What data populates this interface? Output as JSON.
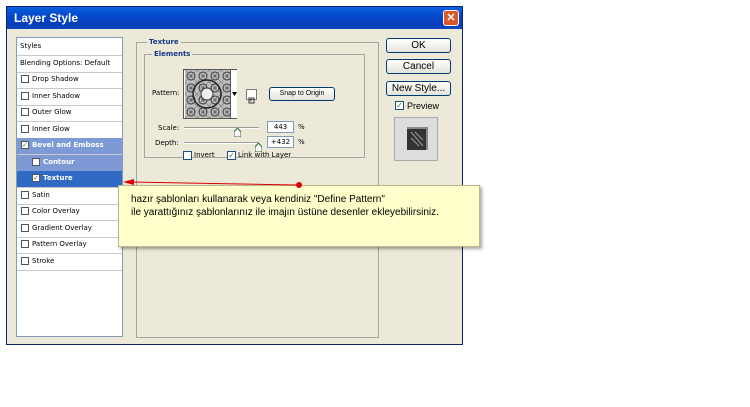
{
  "window": {
    "title": "Layer Style",
    "close_glyph": "✕"
  },
  "styles_list": [
    {
      "label": "Styles",
      "checkbox": false,
      "checked": false,
      "selected": false,
      "sub": false
    },
    {
      "label": "Blending Options: Default",
      "checkbox": false,
      "checked": false,
      "selected": false,
      "sub": false
    },
    {
      "label": "Drop Shadow",
      "checkbox": true,
      "checked": false,
      "selected": false,
      "sub": false
    },
    {
      "label": "Inner Shadow",
      "checkbox": true,
      "checked": false,
      "selected": false,
      "sub": false
    },
    {
      "label": "Outer Glow",
      "checkbox": true,
      "checked": false,
      "selected": false,
      "sub": false
    },
    {
      "label": "Inner Glow",
      "checkbox": true,
      "checked": false,
      "selected": false,
      "sub": false
    },
    {
      "label": "Bevel and Emboss",
      "checkbox": true,
      "checked": true,
      "selected": true,
      "sub": false
    },
    {
      "label": "Contour",
      "checkbox": true,
      "checked": false,
      "selected": true,
      "sub": true
    },
    {
      "label": "Texture",
      "checkbox": true,
      "checked": true,
      "selected": true,
      "sub": true
    },
    {
      "label": "Satin",
      "checkbox": true,
      "checked": false,
      "selected": false,
      "sub": false
    },
    {
      "label": "Color Overlay",
      "checkbox": true,
      "checked": false,
      "selected": false,
      "sub": false
    },
    {
      "label": "Gradient Overlay",
      "checkbox": true,
      "checked": false,
      "selected": false,
      "sub": false
    },
    {
      "label": "Pattern Overlay",
      "checkbox": true,
      "checked": false,
      "selected": false,
      "sub": false
    },
    {
      "label": "Stroke",
      "checkbox": true,
      "checked": false,
      "selected": false,
      "sub": false
    }
  ],
  "texture": {
    "section_title": "Texture",
    "group_title": "Elements",
    "pattern_label": "Pattern:",
    "snap_button": "Snap to Origin",
    "scale_label": "Scale:",
    "scale_value": "443",
    "scale_unit": "%",
    "depth_label": "Depth:",
    "depth_value": "+432",
    "depth_unit": "%",
    "invert_label": "Invert",
    "invert_checked": false,
    "link_label": "Link with Layer",
    "link_checked": true
  },
  "buttons": {
    "ok": "OK",
    "cancel": "Cancel",
    "new_style": "New Style...",
    "preview_label": "Preview"
  },
  "preview_checked": true,
  "tooltip": {
    "line1": "hazır şablonları kullanarak veya kendiniz \"Define Pattern\"",
    "line2": "ile yarattığınız şablonlarınız ile imajın üstüne desenler ekleyebilirsiniz."
  },
  "colors": {
    "title_bar": "#0a46c0",
    "selection": "#316ac5",
    "tooltip_bg": "#ffffcc",
    "arrow": "#dd0000"
  }
}
